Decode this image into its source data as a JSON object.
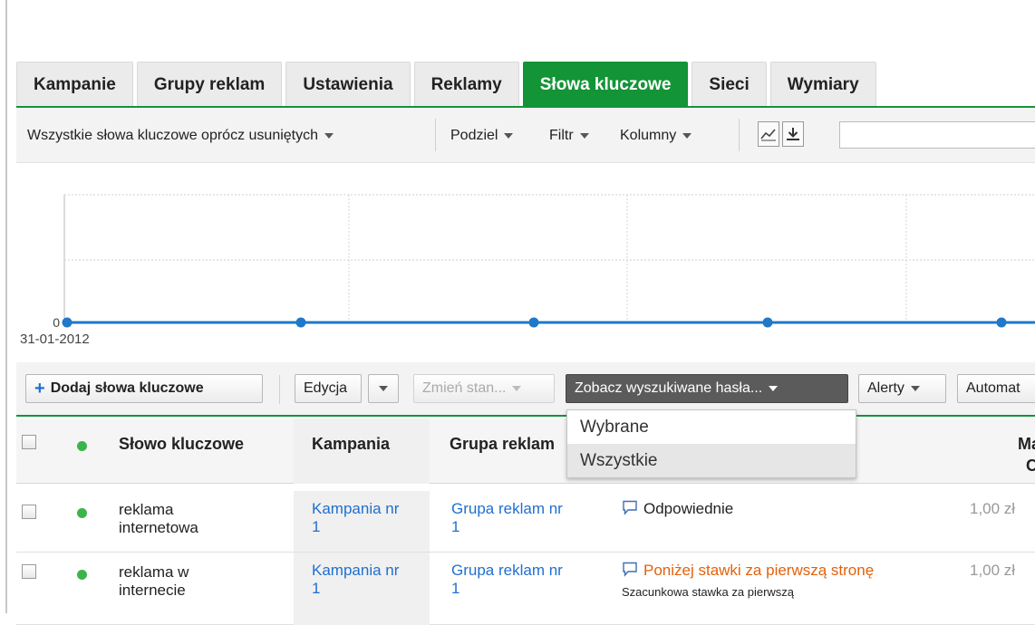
{
  "tabs": [
    {
      "label": "Kampanie",
      "active": false
    },
    {
      "label": "Grupy reklam",
      "active": false
    },
    {
      "label": "Ustawienia",
      "active": false
    },
    {
      "label": "Reklamy",
      "active": false
    },
    {
      "label": "Słowa kluczowe",
      "active": true
    },
    {
      "label": "Sieci",
      "active": false
    },
    {
      "label": "Wymiary",
      "active": false
    }
  ],
  "toolbar": {
    "filter_label": "Wszystkie słowa kluczowe oprócz usuniętych",
    "segment_label": "Podziel",
    "filter2_label": "Filtr",
    "columns_label": "Kolumny",
    "search_value": ""
  },
  "chart_data": {
    "type": "line",
    "x_label": "31-01-2012",
    "y_tick": "0",
    "series": [
      {
        "values": [
          0,
          0,
          0,
          0,
          0
        ]
      }
    ],
    "ylim": [
      0,
      1
    ],
    "grid": true
  },
  "actions": {
    "add_keywords": "Dodaj słowa kluczowe",
    "edit": "Edycja",
    "change_status": "Zmień stan...",
    "search_terms": "Zobacz wyszukiwane hasła...",
    "alerts": "Alerty",
    "automate": "Automat"
  },
  "search_terms_menu": [
    "Wybrane",
    "Wszystkie"
  ],
  "table": {
    "headers": {
      "keyword": "Słowo kluczowe",
      "campaign": "Kampania",
      "ad_group": "Grupa reklam",
      "max_cpc": "Ma",
      "max_cpc_2": "C"
    },
    "rows": [
      {
        "keyword_1": "reklama",
        "keyword_2": "internetowa",
        "campaign_1": "Kampania nr",
        "campaign_2": "1",
        "ad_group_1": "Grupa reklam nr",
        "ad_group_2": "1",
        "status": "Odpowiednie",
        "status_note": "",
        "bid": "1,00 zł"
      },
      {
        "keyword_1": "reklama w",
        "keyword_2": "internecie",
        "campaign_1": "Kampania nr",
        "campaign_2": "1",
        "ad_group_1": "Grupa reklam nr",
        "ad_group_2": "1",
        "status": "Poniżej stawki za pierwszą stronę",
        "status_note": "Szacunkowa stawka za pierwszą",
        "bid": "1,00 zł"
      }
    ]
  },
  "colors": {
    "accent_green": "#139437",
    "link_blue": "#1f6fd0",
    "warning_orange": "#e4600a",
    "status_dot": "#3ab54a",
    "chart_line": "#1f78c8"
  }
}
